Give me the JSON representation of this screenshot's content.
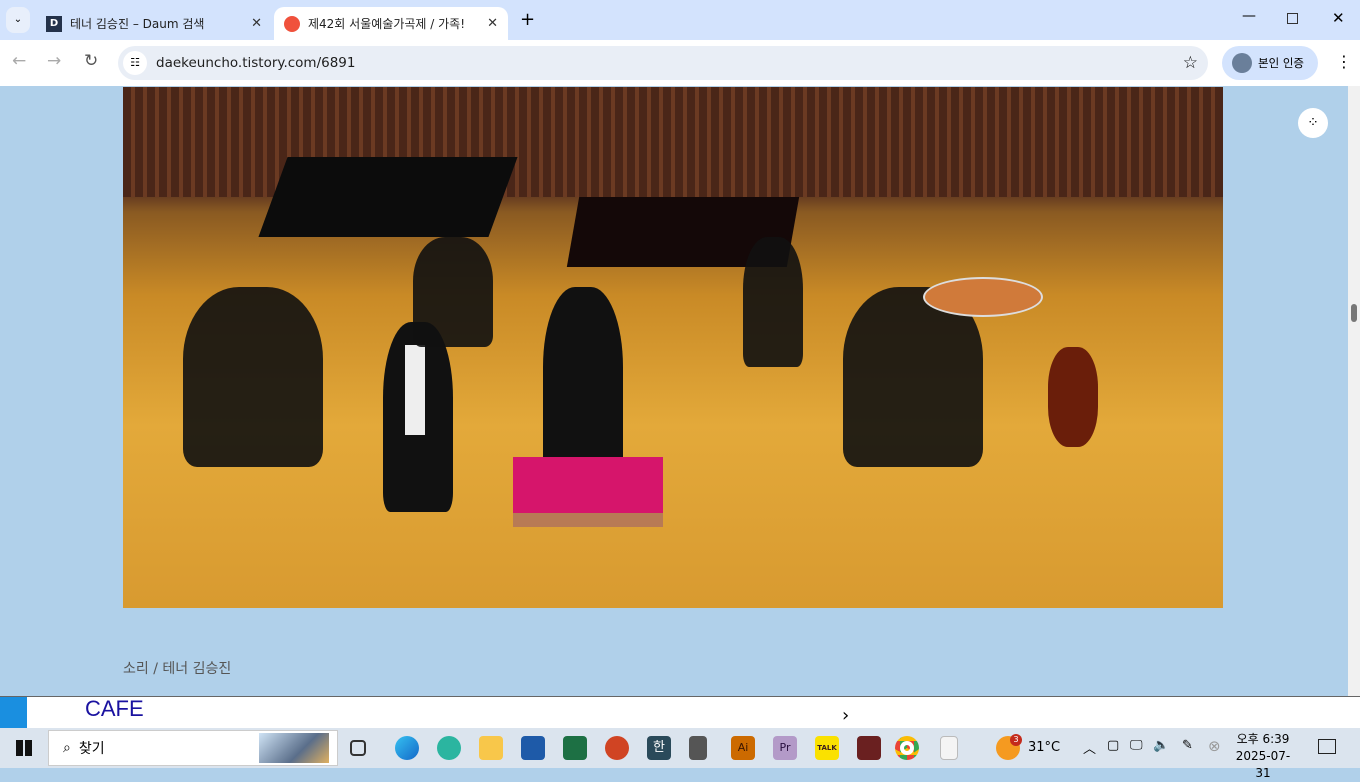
{
  "tabs": [
    {
      "label": "테너 김승진 – Daum 검색",
      "favicon": "D"
    },
    {
      "label": "제42회 서울예술가곡제 / 가족!",
      "favicon": "T"
    }
  ],
  "address": "daekeuncho.tistory.com/6891",
  "profile_label": "본인 인증",
  "caption": "소리 / 테너 김승진",
  "popup": {
    "title": "CAFE"
  },
  "taskbar": {
    "search": "찾기",
    "weather": "31°C",
    "weather_badge": "3",
    "time": "오후 6:39",
    "date": "2025-07-31"
  },
  "icons": {
    "hangul": "한",
    "talk": "TALK",
    "ai": "Ai",
    "pr": "Pr"
  }
}
